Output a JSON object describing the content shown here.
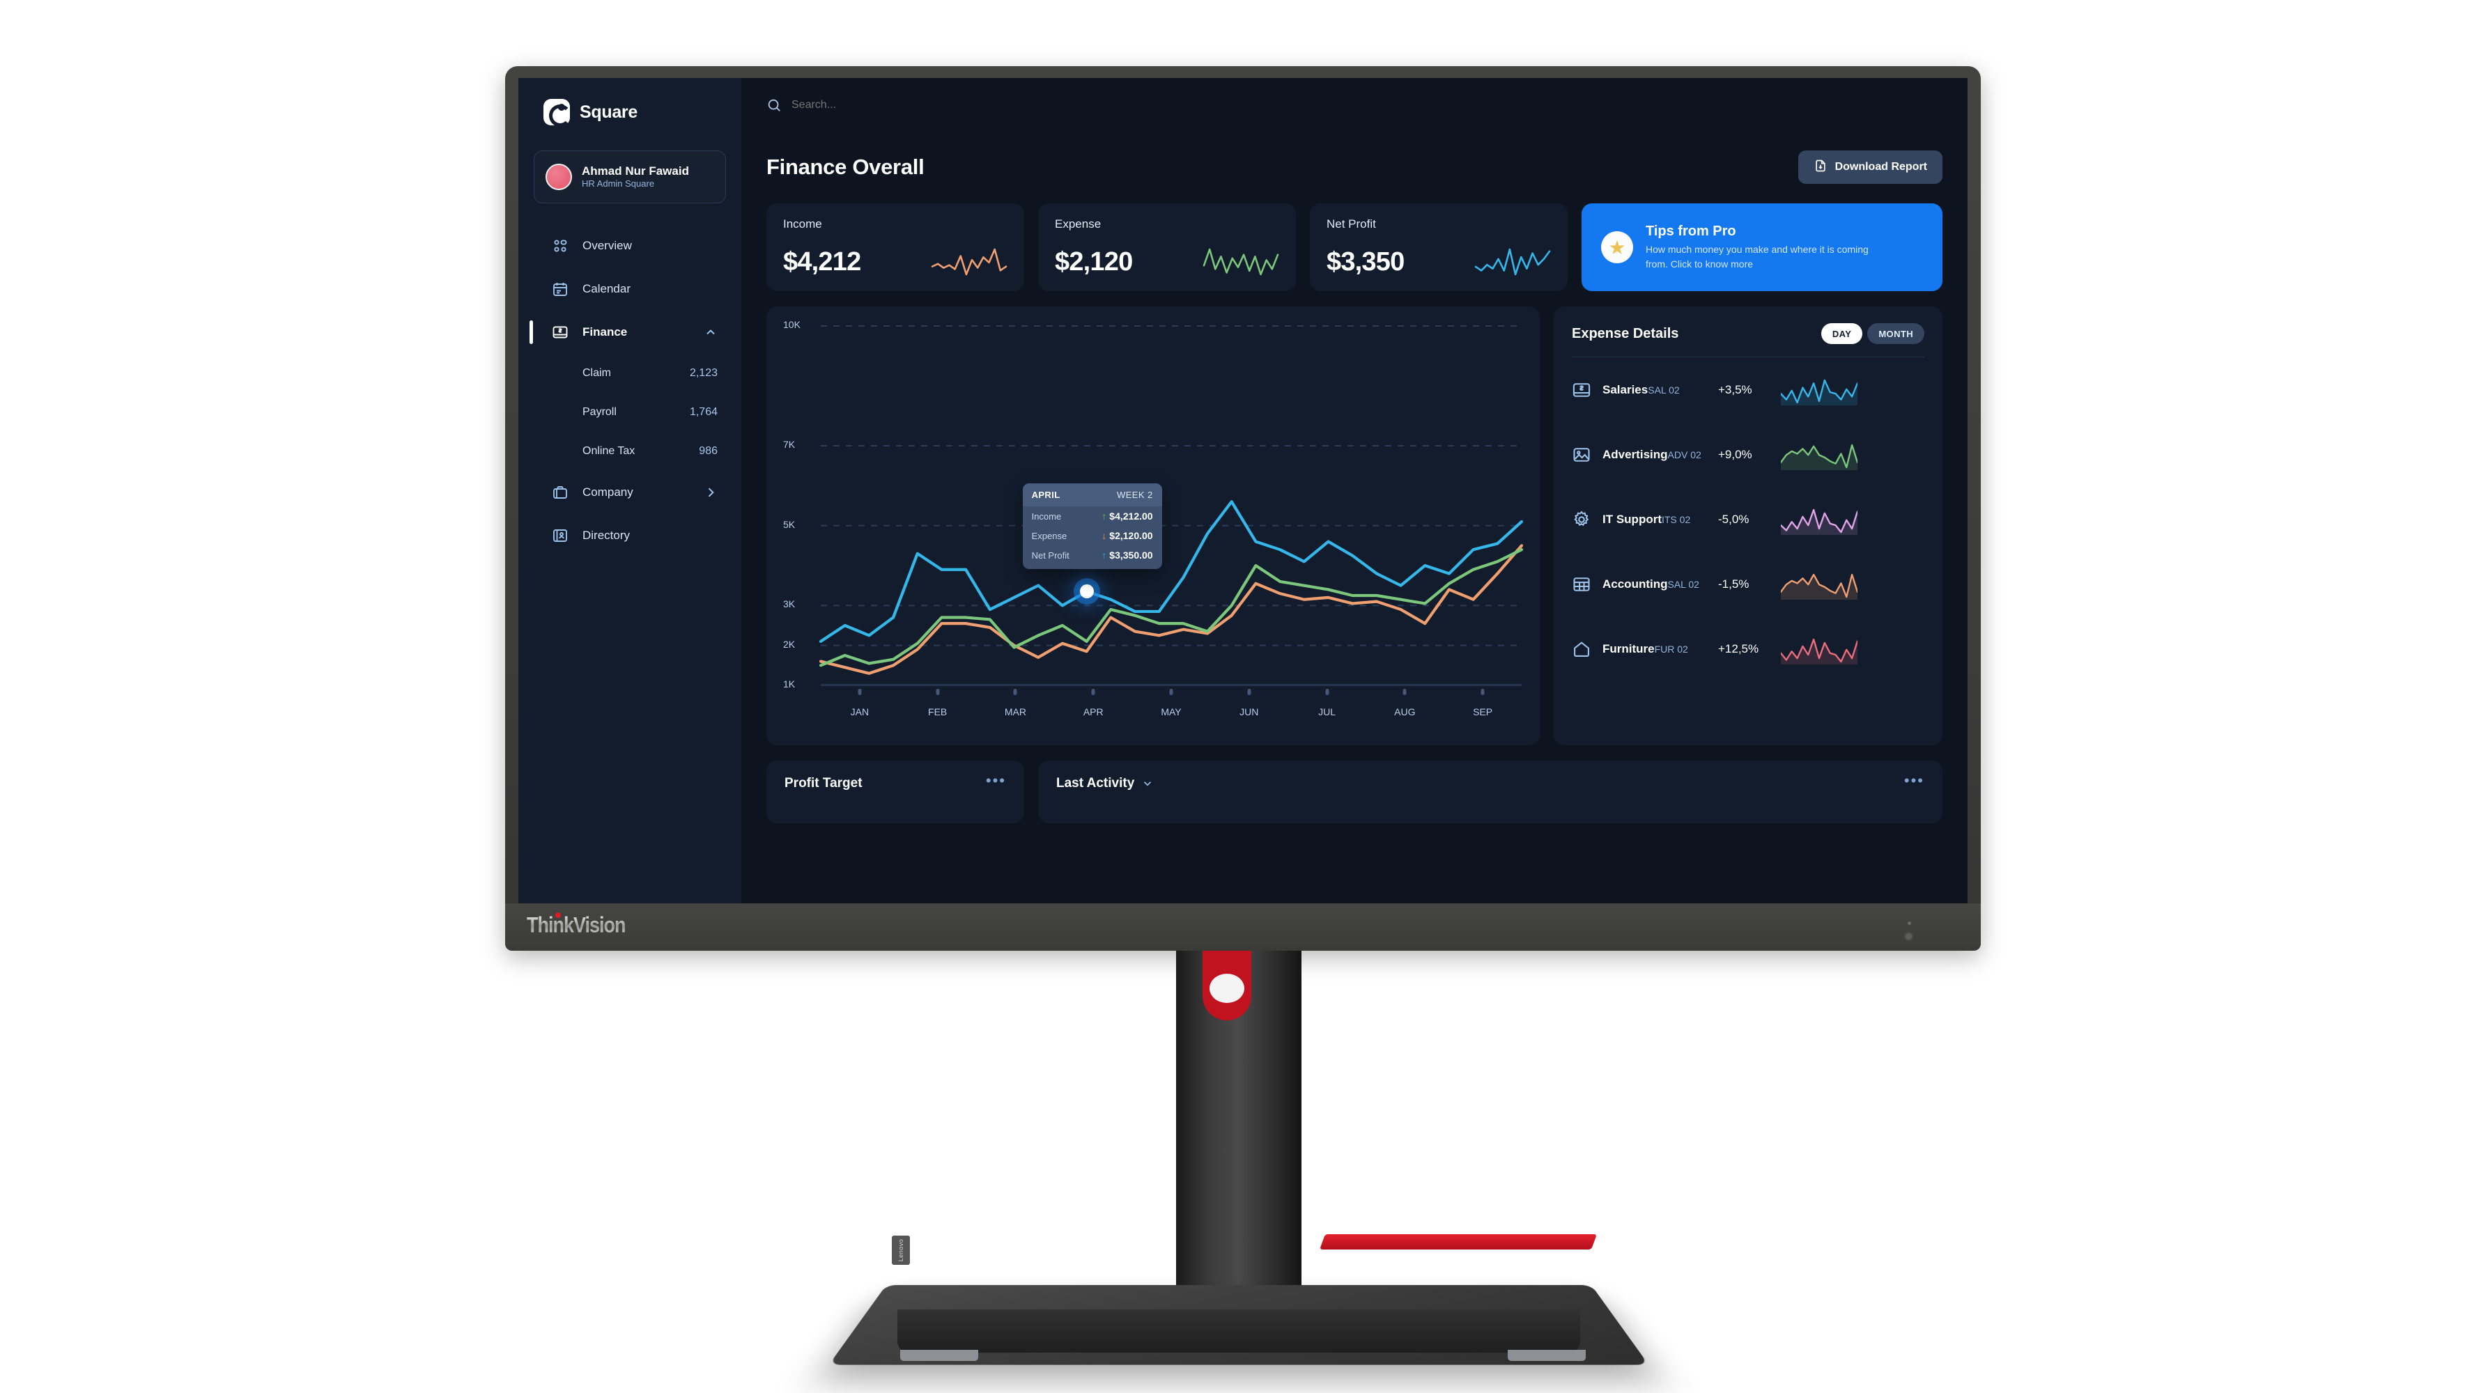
{
  "brand": {
    "name": "Square",
    "logo_icon": "square-logo-icon"
  },
  "profile": {
    "name": "Ahmad Nur Fawaid",
    "role": "HR Admin Square",
    "avatar_icon": "avatar"
  },
  "search": {
    "placeholder": "Search...",
    "icon": "search-icon"
  },
  "sidebar": {
    "items": [
      {
        "label": "Overview",
        "icon": "grid-icon"
      },
      {
        "label": "Calendar",
        "icon": "calendar-icon"
      },
      {
        "label": "Finance",
        "icon": "money-card-icon",
        "active": true,
        "chevron": "chevron-up-icon"
      },
      {
        "label": "Company",
        "icon": "briefcase-icon",
        "chevron": "chevron-right-icon"
      },
      {
        "label": "Directory",
        "icon": "address-book-icon"
      }
    ],
    "finance_sub": [
      {
        "label": "Claim",
        "count": "2,123"
      },
      {
        "label": "Payroll",
        "count": "1,764"
      },
      {
        "label": "Online Tax",
        "count": "986"
      }
    ]
  },
  "header": {
    "title": "Finance Overall",
    "download_label": "Download Report",
    "download_icon": "file-download-icon"
  },
  "stats": [
    {
      "label": "Income",
      "value": "$4,212",
      "color": "#f0a070"
    },
    {
      "label": "Expense",
      "value": "$2,120",
      "color": "#7cc77c"
    },
    {
      "label": "Net Profit",
      "value": "$3,350",
      "color": "#35b7ea"
    }
  ],
  "tips": {
    "title": "Tips from Pro",
    "body": "How much money you make and where it is coming from. Click to know more",
    "icon": "star-icon",
    "bg": "#1479f0"
  },
  "tooltip": {
    "month": "APRIL",
    "week": "WEEK 2",
    "rows": [
      {
        "label": "Income",
        "value": "$4,212.00",
        "dir": "up",
        "color": "#5ec45e"
      },
      {
        "label": "Expense",
        "value": "$2,120.00",
        "dir": "down",
        "color": "#e8963c"
      },
      {
        "label": "Net Profit",
        "value": "$3,350.00",
        "dir": "up",
        "color": "#2aa9ef"
      }
    ]
  },
  "expense_details": {
    "title": "Expense Details",
    "toggle": {
      "day": "DAY",
      "month": "MONTH",
      "active": "DAY"
    },
    "rows": [
      {
        "name": "Salaries",
        "code": "SAL 02",
        "pct": "+3,5%",
        "color": "#35b7ea",
        "icon": "money-card-icon"
      },
      {
        "name": "Advertising",
        "code": "ADV 02",
        "pct": "+9,0%",
        "color": "#7cc77c",
        "icon": "image-icon"
      },
      {
        "name": "IT Support",
        "code": "ITS 02",
        "pct": "-5,0%",
        "color": "#e0a4e8",
        "icon": "gear-icon"
      },
      {
        "name": "Accounting",
        "code": "SAL 02",
        "pct": "-1,5%",
        "color": "#f0a070",
        "icon": "table-icon"
      },
      {
        "name": "Furniture",
        "code": "FUR 02",
        "pct": "+12,5%",
        "color": "#ea6d7e",
        "icon": "home-icon"
      }
    ]
  },
  "bottom": {
    "profit_target": {
      "title": "Profit Target",
      "menu_icon": "ellipsis-icon"
    },
    "last_activity": {
      "title": "Last Activity",
      "chevron": "chevron-down-icon",
      "menu_icon": "ellipsis-icon"
    }
  },
  "monitor": {
    "brand": "ThinkVision",
    "base_badge": "Lenovo"
  },
  "chart_data": {
    "type": "line",
    "title": "Finance Overall",
    "xlabel": "",
    "ylabel": "",
    "grid": true,
    "legend_position": "none",
    "x": [
      "JAN",
      "FEB",
      "MAR",
      "APR",
      "MAY",
      "JUN",
      "JUL",
      "AUG",
      "SEP"
    ],
    "ytick_labels": [
      "1K",
      "2K",
      "3K",
      "5K",
      "7K",
      "10K"
    ],
    "ytick_values": [
      1000,
      2000,
      3000,
      5000,
      7000,
      10000
    ],
    "ylim": [
      1000,
      10000
    ],
    "series": [
      {
        "name": "Net Profit",
        "color": "#35b7ea",
        "values": [
          2100,
          2500,
          2250,
          2700,
          4300,
          3900,
          3900,
          2900,
          3200,
          3500,
          3000,
          3350,
          3150,
          2850,
          2850,
          3700,
          4800,
          5600,
          4600,
          4400,
          4100,
          4600,
          4250,
          3800,
          3500,
          4000,
          3800,
          4400,
          4550,
          5100
        ]
      },
      {
        "name": "Expense",
        "color": "#7cc77c",
        "values": [
          1500,
          1750,
          1550,
          1650,
          2050,
          2700,
          2700,
          2650,
          1950,
          2250,
          2500,
          2100,
          2900,
          2750,
          2550,
          2550,
          2350,
          3000,
          4000,
          3600,
          3500,
          3400,
          3250,
          3250,
          3150,
          3050,
          3550,
          3900,
          4100,
          4400
        ]
      },
      {
        "name": "Income",
        "color": "#f0a070",
        "values": [
          1600,
          1450,
          1300,
          1500,
          1900,
          2550,
          2550,
          2450,
          2000,
          1700,
          2050,
          1850,
          2700,
          2350,
          2250,
          2400,
          2300,
          2750,
          3550,
          3300,
          3150,
          3200,
          3050,
          3100,
          2900,
          2550,
          3400,
          3150,
          3800,
          4500
        ]
      }
    ],
    "highlight": {
      "x": "APR",
      "label": "WEEK 2",
      "income": 4212,
      "expense": 2120,
      "net_profit": 3350
    }
  },
  "sparklines": {
    "income": [
      30,
      34,
      28,
      32,
      26,
      46,
      18,
      40,
      28,
      44,
      36,
      56,
      24,
      30
    ],
    "expense": [
      34,
      52,
      30,
      44,
      26,
      42,
      32,
      46,
      28,
      44,
      24,
      40,
      30,
      46
    ],
    "net_profit": [
      28,
      24,
      30,
      26,
      36,
      24,
      46,
      20,
      38,
      26,
      42,
      30,
      36,
      44
    ],
    "salaries": [
      30,
      22,
      34,
      18,
      38,
      26,
      44,
      20,
      48,
      32,
      30,
      22,
      36,
      26,
      44
    ],
    "advertising": [
      22,
      34,
      40,
      36,
      44,
      34,
      48,
      34,
      30,
      24,
      20,
      36,
      14,
      50,
      22
    ],
    "it_support": [
      26,
      20,
      30,
      22,
      36,
      26,
      44,
      22,
      40,
      28,
      26,
      18,
      32,
      22,
      42
    ],
    "accounting": [
      20,
      32,
      38,
      34,
      42,
      32,
      48,
      32,
      28,
      22,
      18,
      34,
      12,
      48,
      20
    ],
    "furniture": [
      26,
      18,
      28,
      20,
      34,
      24,
      42,
      20,
      38,
      26,
      24,
      16,
      30,
      20,
      40
    ]
  }
}
